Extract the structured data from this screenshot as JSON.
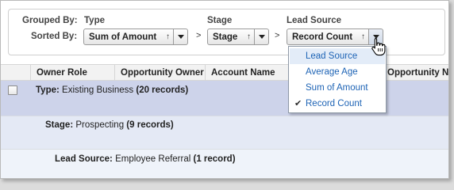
{
  "grouping": {
    "grouped_by_label": "Grouped By:",
    "sorted_by_label": "Sorted By:",
    "separator": ">",
    "columns": [
      {
        "header": "Type",
        "sort_value": "Sum of Amount",
        "direction": "↑"
      },
      {
        "header": "Stage",
        "sort_value": "Stage",
        "direction": "↑"
      },
      {
        "header": "Lead Source",
        "sort_value": "Record Count",
        "direction": "↑"
      }
    ]
  },
  "table": {
    "headers": [
      "Owner Role",
      "Opportunity Owner",
      "Account Name",
      "Opportunity Name"
    ],
    "rows": [
      {
        "label": "Type:",
        "value": "Existing Business",
        "count": "(20 records)"
      },
      {
        "label": "Stage:",
        "value": "Prospecting",
        "count": "(9 records)"
      },
      {
        "label": "Lead Source:",
        "value": "Employee Referral",
        "count": "(1 record)"
      }
    ]
  },
  "dropdown_menu": {
    "items": [
      {
        "label": "Lead Source",
        "checked": false,
        "hover": true
      },
      {
        "label": "Average Age",
        "checked": false,
        "hover": false
      },
      {
        "label": "Sum of Amount",
        "checked": false,
        "hover": false
      },
      {
        "label": "Record Count",
        "checked": true,
        "hover": false
      }
    ],
    "check_glyph": "✔"
  },
  "colors": {
    "row_type_bg": "#cdd3ea",
    "row_stage_bg": "#e4e9f5",
    "row_lead_bg": "#eff3fa",
    "menu_link": "#1d63b5",
    "menu_hover": "#e3ecf8"
  }
}
